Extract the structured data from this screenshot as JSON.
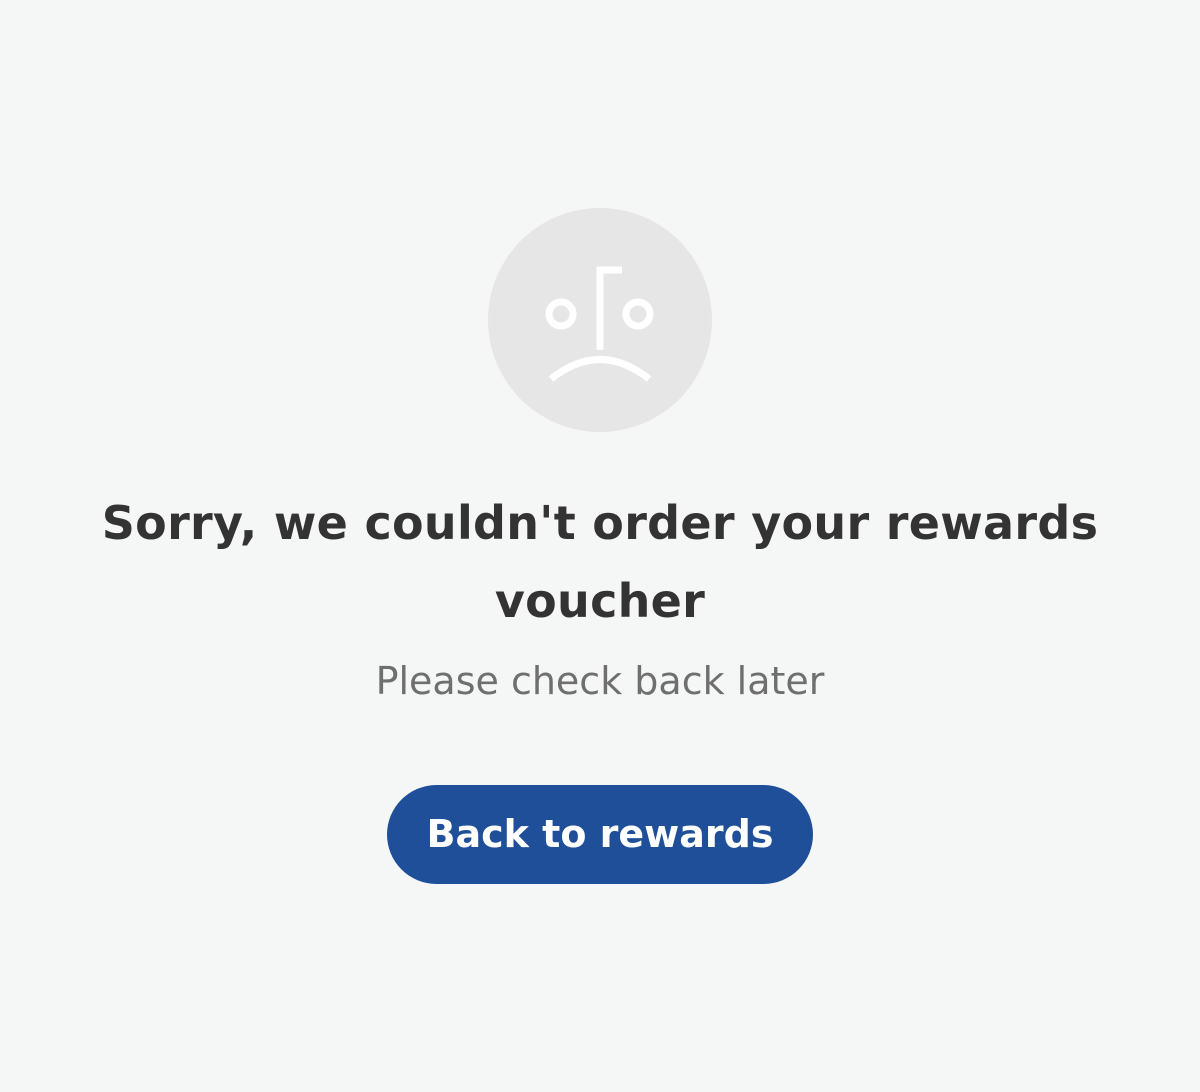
{
  "error": {
    "icon": "sad-face-icon",
    "title": "Sorry, we couldn't order your rewards voucher",
    "subtitle": "Please check back later"
  },
  "actions": {
    "back_label": "Back to rewards"
  },
  "colors": {
    "background": "#f5f6f6",
    "icon_circle": "#e6e6e6",
    "title_text": "#333333",
    "subtitle_text": "#6f6f6f",
    "button_bg": "#1f4f98",
    "button_text": "#ffffff"
  }
}
